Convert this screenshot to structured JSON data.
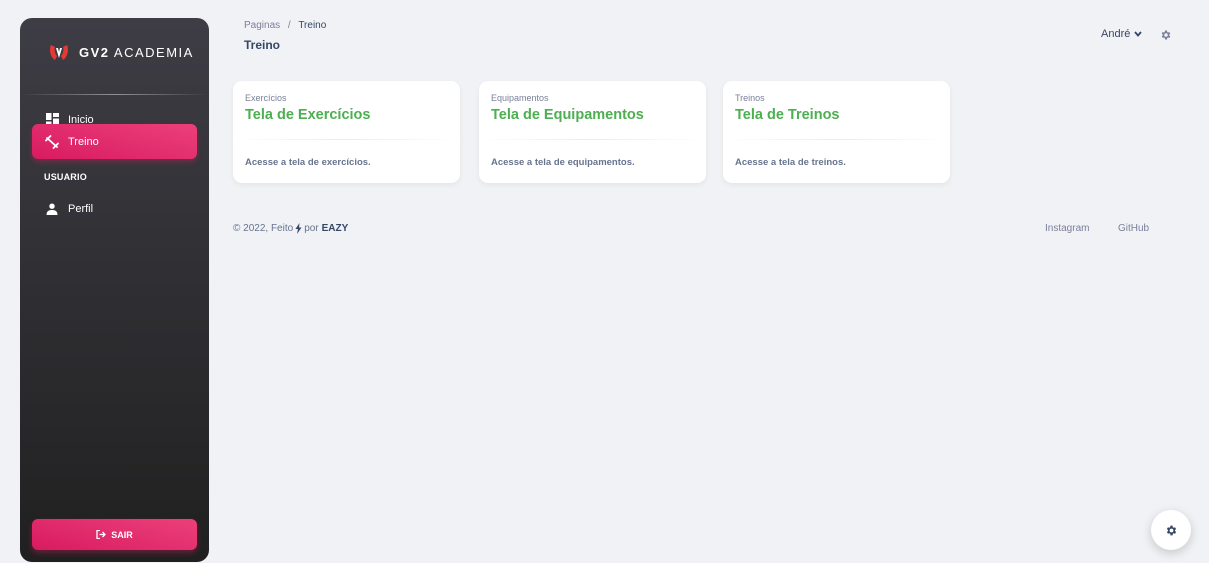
{
  "sidebar": {
    "brand_bold": "GV2",
    "brand_rest": "ACADEMIA",
    "items": [
      {
        "label": "Inicio",
        "icon": "dashboard-icon"
      },
      {
        "label": "Treino",
        "icon": "fitness-icon"
      }
    ],
    "section_label": "USUARIO",
    "profile_label": "Perfil",
    "logout_label": "SAIR"
  },
  "header": {
    "breadcrumb_root": "Paginas",
    "breadcrumb_sep": "/",
    "breadcrumb_current": "Treino",
    "title": "Treino",
    "user_name": "André"
  },
  "cards": [
    {
      "subtitle": "Exercícios",
      "title": "Tela de Exercícios",
      "description": "Acesse a tela de exercícios."
    },
    {
      "subtitle": "Equipamentos",
      "title": "Tela de Equipamentos",
      "description": "Acesse a tela de equipamentos."
    },
    {
      "subtitle": "Treinos",
      "title": "Tela de Treinos",
      "description": "Acesse a tela de treinos."
    }
  ],
  "footer": {
    "copyright": "© 2022, Feito",
    "by": "por",
    "brand": "EAZY",
    "links": [
      "Instagram",
      "GitHub"
    ]
  },
  "colors": {
    "accent": "#e91e63",
    "card_title": "#4caf50",
    "sidebar_dark": "#202020"
  }
}
